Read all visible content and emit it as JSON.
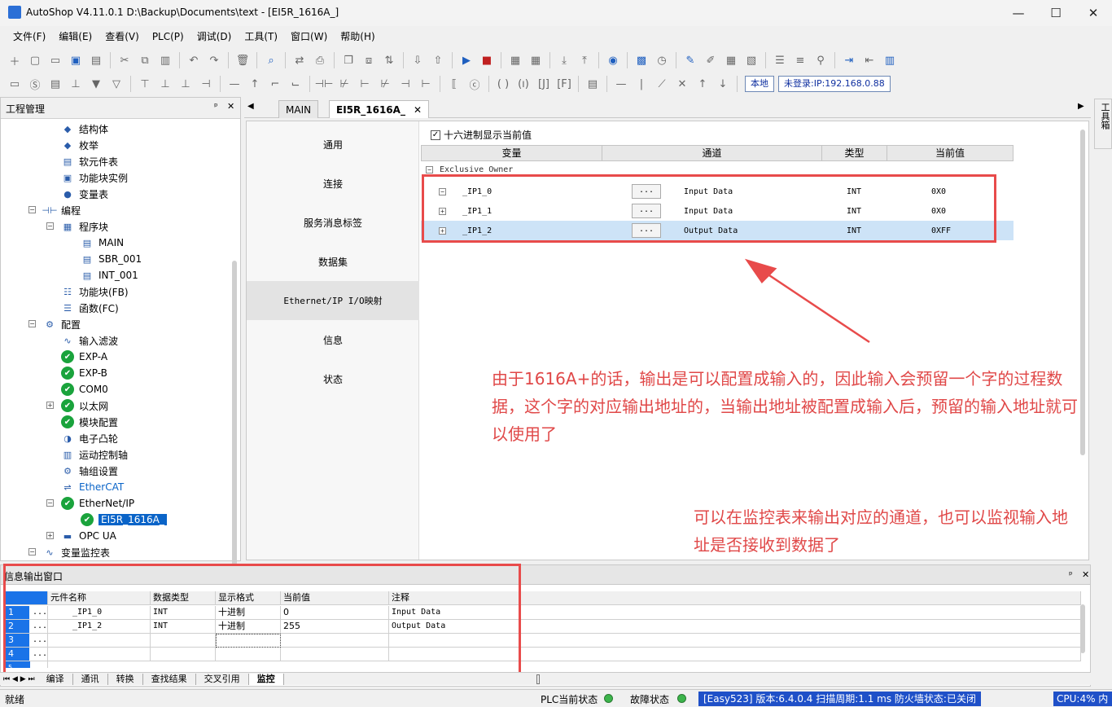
{
  "window": {
    "title": "AutoShop V4.11.0.1  D:\\Backup\\Documents\\text - [EI5R_1616A_]",
    "minimize": "—",
    "maximize": "☐",
    "close": "✕"
  },
  "menu": [
    "文件(F)",
    "编辑(E)",
    "查看(V)",
    "PLC(P)",
    "调试(D)",
    "工具(T)",
    "窗口(W)",
    "帮助(H)"
  ],
  "toolbar2": {
    "local_label": "本地",
    "login_label": "未登录:IP:192.168.0.88"
  },
  "project_panel": {
    "title": "工程管理",
    "pin": "ᵖ",
    "close": "✕",
    "tree": [
      {
        "label": "结构体",
        "icon": "struct-icon"
      },
      {
        "label": "枚举",
        "icon": "enum-icon"
      },
      {
        "label": "软元件表",
        "icon": "device-table-icon"
      },
      {
        "label": "功能块实例",
        "icon": "fb-instance-icon"
      },
      {
        "label": "变量表",
        "icon": "variable-table-icon"
      },
      {
        "label": "编程",
        "icon": "programming-icon"
      },
      {
        "label": "程序块",
        "icon": "program-block-icon"
      },
      {
        "label": "MAIN",
        "icon": "program-icon"
      },
      {
        "label": "SBR_001",
        "icon": "program-icon"
      },
      {
        "label": "INT_001",
        "icon": "program-icon"
      },
      {
        "label": "功能块(FB)",
        "icon": "fb-icon"
      },
      {
        "label": "函数(FC)",
        "icon": "fc-icon"
      },
      {
        "label": "配置",
        "icon": "config-icon"
      },
      {
        "label": "输入滤波",
        "icon": "filter-icon"
      },
      {
        "label": "EXP-A",
        "icon": "check-icon"
      },
      {
        "label": "EXP-B",
        "icon": "check-icon"
      },
      {
        "label": "COM0",
        "icon": "check-icon"
      },
      {
        "label": "以太网",
        "icon": "check-icon"
      },
      {
        "label": "模块配置",
        "icon": "check-icon"
      },
      {
        "label": "电子凸轮",
        "icon": "cam-icon"
      },
      {
        "label": "运动控制轴",
        "icon": "axis-icon"
      },
      {
        "label": "轴组设置",
        "icon": "gear-icon"
      },
      {
        "label": "EtherCAT",
        "icon": "ethercat-icon"
      },
      {
        "label": "EtherNet/IP",
        "icon": "check-icon"
      },
      {
        "label": "EI5R_1616A_",
        "icon": "check-icon"
      },
      {
        "label": "OPC UA",
        "icon": "opcua-icon"
      },
      {
        "label": "变量监控表",
        "icon": "monitor-icon"
      }
    ]
  },
  "editor_tabs": [
    {
      "label": "MAIN"
    },
    {
      "label": "EI5R_1616A_"
    }
  ],
  "editor": {
    "nav": [
      "通用",
      "连接",
      "服务消息标签",
      "数据集",
      "Ethernet/IP I/O映射",
      "信息",
      "状态"
    ],
    "hex_checkbox": "十六进制显示当前值",
    "columns": [
      "变量",
      "通道",
      "类型",
      "当前值"
    ],
    "group": "Exclusive Owner",
    "rows": [
      {
        "var": "_IP1_0",
        "btn": "...",
        "channel": "Input Data",
        "type": "INT",
        "value": "0X0"
      },
      {
        "var": "_IP1_1",
        "btn": "...",
        "channel": "Input Data",
        "type": "INT",
        "value": "0X0"
      },
      {
        "var": "_IP1_2",
        "btn": "...",
        "channel": "Output Data",
        "type": "INT",
        "value": "0XFF"
      }
    ]
  },
  "annotations": {
    "note1": "由于1616A+的话，输出是可以配置成输入的，因此输入会预留一个字的过程数据，这个字的对应输出地址的，当输出地址被配置成输入后，预留的输入地址就可以使用了",
    "note2": "可以在监控表来输出对应的通道，也可以监视输入地址是否接收到数据了"
  },
  "toolbox_tab": "工具箱",
  "output_panel": {
    "title": "信息输出窗口",
    "columns": [
      "元件名称",
      "数据类型",
      "显示格式",
      "当前值",
      "注释"
    ],
    "rows": [
      {
        "idx": "1",
        "dots": "...",
        "name": "_IP1_0",
        "type": "INT",
        "fmt": "十进制",
        "value": "0",
        "comment": "Input Data"
      },
      {
        "idx": "2",
        "dots": "...",
        "name": "_IP1_2",
        "type": "INT",
        "fmt": "十进制",
        "value": "255",
        "comment": "Output Data"
      },
      {
        "idx": "3",
        "dots": "...",
        "name": "",
        "type": "",
        "fmt": "",
        "value": "",
        "comment": ""
      },
      {
        "idx": "4",
        "dots": "...",
        "name": "",
        "type": "",
        "fmt": "",
        "value": "",
        "comment": ""
      },
      {
        "idx": "5",
        "dots": "",
        "name": "",
        "type": "",
        "fmt": "",
        "value": "",
        "comment": ""
      }
    ],
    "tabs": [
      "编译",
      "通讯",
      "转换",
      "查找结果",
      "交叉引用",
      "监控"
    ]
  },
  "statusbar": {
    "ready": "就绪",
    "plc_state": "PLC当前状态",
    "fault_state": "故障状态",
    "info": "[Easy523] 版本:6.4.0.4 扫描周期:1.1 ms 防火墙状态:已关闭",
    "cpu": "CPU:4% 内"
  },
  "colors": {
    "accent": "#0a64c8",
    "annotation_red": "#e84b4b",
    "status_blue": "#1f50c8",
    "ok_green": "#1aa33c"
  }
}
